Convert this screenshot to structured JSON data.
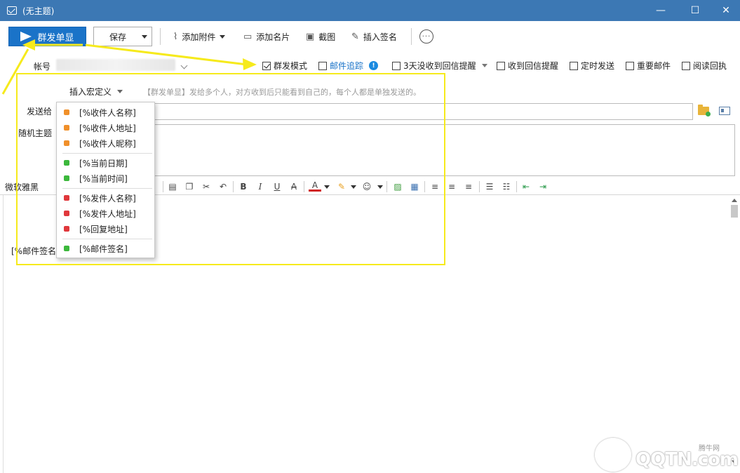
{
  "window": {
    "title": "(无主题)",
    "controls": {
      "minimize": "—",
      "maximize": "☐",
      "close": "✕"
    }
  },
  "toolbar": {
    "send_label": "群发单显",
    "save_label": "保存",
    "attach_label": "添加附件",
    "card_label": "添加名片",
    "screenshot_label": "截图",
    "signature_label": "插入签名",
    "more_label": "···"
  },
  "account": {
    "label": "帐号"
  },
  "options": {
    "mass_mode": {
      "label": "群发模式",
      "checked": true
    },
    "tracking": {
      "label": "邮件追踪",
      "checked": false,
      "link_color": "#1a73c8"
    },
    "no_reply_reminder": {
      "label": "3天没收到回信提醒",
      "checked": false
    },
    "reply_reminder": {
      "label": "收到回信提醒",
      "checked": false
    },
    "scheduled": {
      "label": "定时发送",
      "checked": false
    },
    "important": {
      "label": "重要邮件",
      "checked": false
    },
    "read_receipt": {
      "label": "阅读回执",
      "checked": false
    }
  },
  "form": {
    "macro_label": "插入宏定义",
    "hint": "【群发单显】发给多个人，对方收到后只能看到自己的，每个人都是单独发送的。",
    "to_label": "发送给",
    "subject_label": "随机主题"
  },
  "format": {
    "font_name": "微软雅黑",
    "buttons": {
      "bold": "B",
      "italic": "I",
      "underline": "U",
      "strike": "A",
      "font_color": "A"
    }
  },
  "editor": {
    "signature_text": "[%邮件签名]"
  },
  "macro_menu": {
    "items": [
      {
        "label": "[%收件人名称]",
        "color": "#f0902a"
      },
      {
        "label": "[%收件人地址]",
        "color": "#f0902a"
      },
      {
        "label": "[%收件人昵称]",
        "color": "#f0902a"
      },
      {
        "label": "[%当前日期]",
        "color": "#3cb83c"
      },
      {
        "label": "[%当前时间]",
        "color": "#3cb83c"
      },
      {
        "label": "[%发件人名称]",
        "color": "#e0383c"
      },
      {
        "label": "[%发件人地址]",
        "color": "#e0383c"
      },
      {
        "label": "[%回复地址]",
        "color": "#e0383c"
      },
      {
        "label": "[%邮件签名]",
        "color": "#3cb83c"
      }
    ]
  },
  "watermark": {
    "text": "QQTN.com",
    "site": "腾牛网"
  },
  "colors": {
    "titlebar": "#3c78b4",
    "primary_button": "#1a73c8",
    "highlight": "#f6ea1c"
  }
}
